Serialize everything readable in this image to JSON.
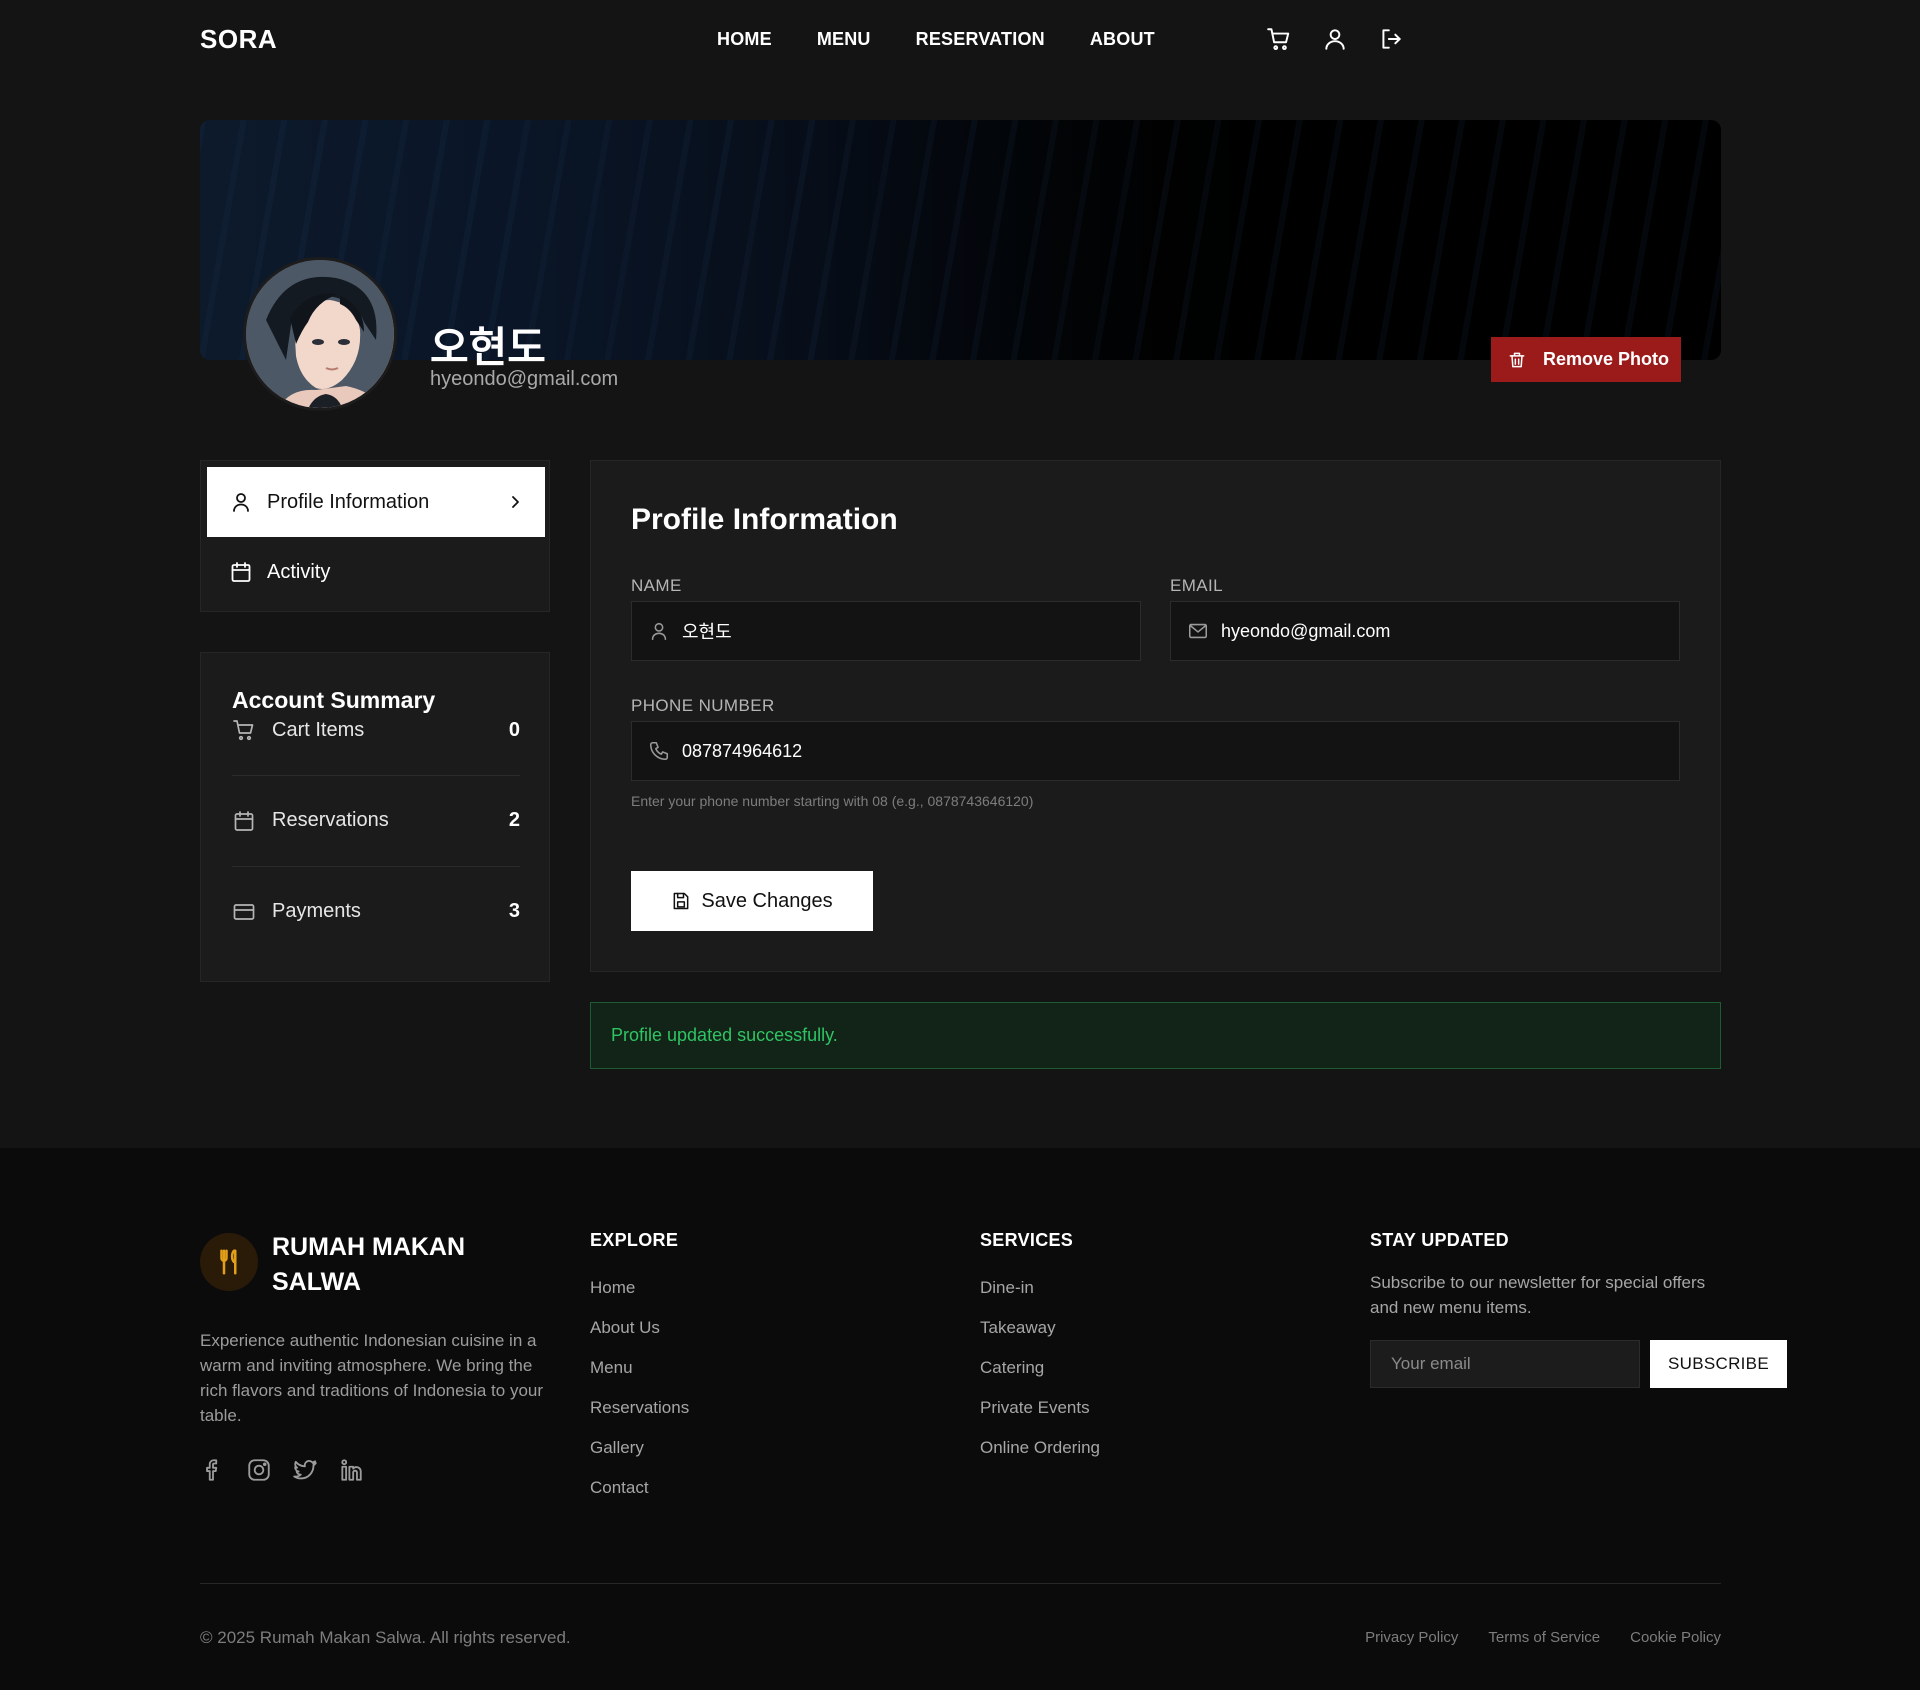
{
  "header": {
    "logo": "SORA",
    "nav": [
      "HOME",
      "MENU",
      "RESERVATION",
      "ABOUT"
    ],
    "icons": [
      "cart-icon",
      "user-icon",
      "logout-icon"
    ]
  },
  "profile": {
    "name": "오현도",
    "email": "hyeondo@gmail.com",
    "remove_photo_label": "Remove Photo"
  },
  "side_menu": {
    "items": [
      {
        "label": "Profile Information",
        "icon": "user-icon",
        "active": true
      },
      {
        "label": "Activity",
        "icon": "calendar-icon",
        "active": false
      }
    ]
  },
  "account_summary": {
    "title": "Account Summary",
    "rows": [
      {
        "label": "Cart Items",
        "value": "0",
        "icon": "cart-icon"
      },
      {
        "label": "Reservations",
        "value": "2",
        "icon": "calendar-icon"
      },
      {
        "label": "Payments",
        "value": "3",
        "icon": "credit-card-icon"
      }
    ]
  },
  "form": {
    "title": "Profile Information",
    "name_label": "NAME",
    "name_value": "오현도",
    "email_label": "EMAIL",
    "email_value": "hyeondo@gmail.com",
    "phone_label": "PHONE NUMBER",
    "phone_value": "087874964612",
    "phone_help": "Enter your phone number starting with 08 (e.g., 0878743646120)",
    "save_label": "Save Changes"
  },
  "alert": {
    "message": "Profile updated successfully.",
    "color": "#2fc463"
  },
  "footer": {
    "brand": "RUMAH MAKAN SALWA",
    "description": "Experience authentic Indonesian cuisine in a warm and inviting atmosphere. We bring the rich flavors and traditions of Indonesia to your table.",
    "socials": [
      "facebook-icon",
      "instagram-icon",
      "twitter-icon",
      "linkedin-icon"
    ],
    "explore": {
      "title": "EXPLORE",
      "links": [
        "Home",
        "About Us",
        "Menu",
        "Reservations",
        "Gallery",
        "Contact"
      ]
    },
    "services": {
      "title": "SERVICES",
      "links": [
        "Dine-in",
        "Takeaway",
        "Catering",
        "Private Events",
        "Online Ordering"
      ]
    },
    "newsletter": {
      "title": "STAY UPDATED",
      "text": "Subscribe to our newsletter for special offers and new menu items.",
      "placeholder": "Your email",
      "button": "SUBSCRIBE"
    },
    "copyright": "© 2025 Rumah Makan Salwa. All rights reserved.",
    "legal": [
      "Privacy Policy",
      "Terms of Service",
      "Cookie Policy"
    ]
  },
  "colors": {
    "background": "#141414",
    "card": "#1b1b1b",
    "danger": "#9b1b1b",
    "success_text": "#2fc463",
    "brand_accent": "#e2a019"
  }
}
